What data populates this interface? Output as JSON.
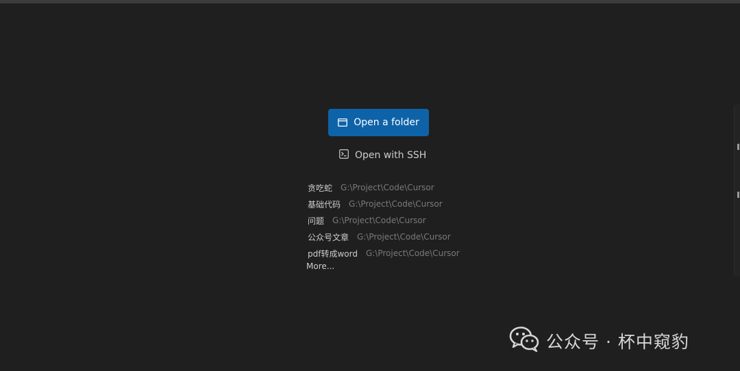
{
  "buttons": {
    "open_folder": "Open a folder",
    "open_ssh": "Open with SSH"
  },
  "recent": [
    {
      "name": "贪吃蛇",
      "path": "G:\\Project\\Code\\Cursor"
    },
    {
      "name": "基础代码",
      "path": "G:\\Project\\Code\\Cursor"
    },
    {
      "name": "问题",
      "path": "G:\\Project\\Code\\Cursor"
    },
    {
      "name": "公众号文章",
      "path": "G:\\Project\\Code\\Cursor"
    },
    {
      "name": "pdf转成word",
      "path": "G:\\Project\\Code\\Cursor"
    }
  ],
  "more_label": "More...",
  "watermark": {
    "text": "公众号 · 杯中窥豹"
  },
  "icons": {
    "folder": "folder-icon",
    "terminal": "terminal-icon",
    "wechat": "wechat-logo-icon"
  },
  "colors": {
    "background": "#1f1f1f",
    "primary_button": "#0e63a8",
    "text": "#cccccc",
    "muted_text": "#7a7a7a"
  }
}
